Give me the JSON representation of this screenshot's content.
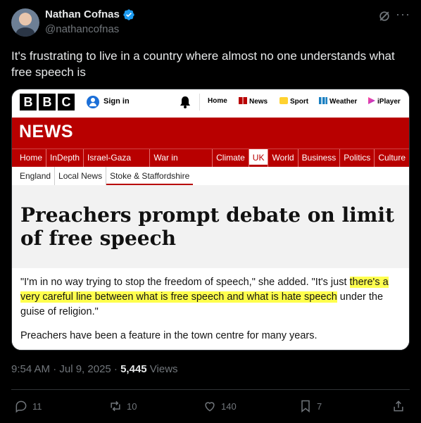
{
  "author": {
    "name": "Nathan Cofnas",
    "handle": "@nathancofnas"
  },
  "tweet": {
    "text": "It's frustrating to live in a country where almost no one understands what free speech is"
  },
  "embedded_image": {
    "bbc_logo": [
      "B",
      "B",
      "C"
    ],
    "sign_in": "Sign in",
    "top_nav": [
      {
        "label": "Home",
        "icon": "none"
      },
      {
        "label": "News",
        "icon": "news-icon"
      },
      {
        "label": "Sport",
        "icon": "sport-icon"
      },
      {
        "label": "Weather",
        "icon": "weather-icon"
      },
      {
        "label": "iPlayer",
        "icon": "iplayer-icon"
      }
    ],
    "section_title": "NEWS",
    "news_nav": [
      "Home",
      "InDepth",
      "Israel-Gaza war",
      "War in Ukraine",
      "Climate",
      "UK",
      "World",
      "Business",
      "Politics",
      "Culture"
    ],
    "news_nav_active": "UK",
    "sub_nav": [
      "England",
      "Local News",
      "Stoke & Staffordshire"
    ],
    "sub_nav_active": "Stoke & Staffordshire",
    "headline": "Preachers prompt debate on limit of free speech",
    "quote_part1": "\"I'm in no way trying to stop the freedom of speech,\" she added. \"It's just ",
    "quote_highlight": "there's a very careful line between what is free speech and what is hate speech",
    "quote_part2": " under the guise of religion.\"",
    "paragraph2": "Preachers have been a feature in the town centre for many years.",
    "colors": {
      "bbc_red": "#b80000",
      "highlight": "#ffff4d"
    }
  },
  "meta": {
    "time": "9:54 AM · Jul 9, 2025 · ",
    "views_count": "5,445",
    "views_label": " Views"
  },
  "actions": {
    "replies": "11",
    "reposts": "10",
    "likes": "140",
    "bookmarks": "7"
  },
  "colors": {
    "background": "#000000",
    "verified": "#1d9bf0",
    "muted": "#71767b"
  }
}
